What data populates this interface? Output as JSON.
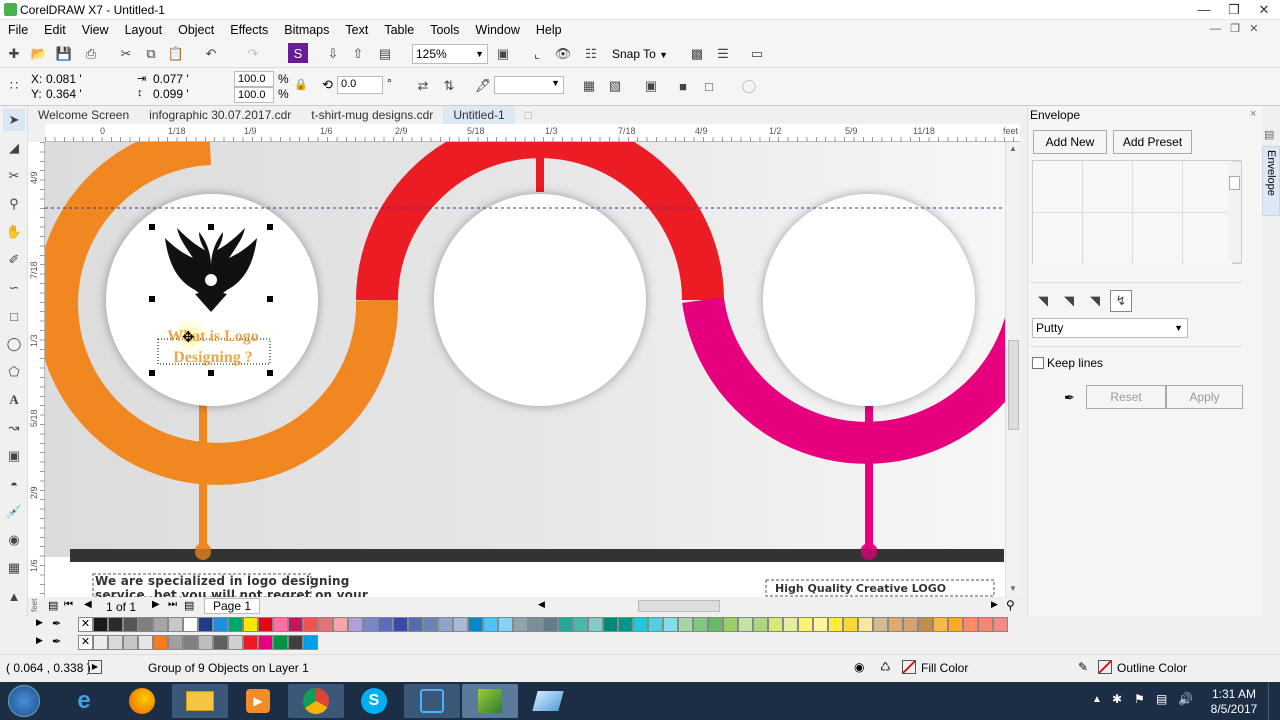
{
  "app": {
    "title": "CorelDRAW X7 - Untitled-1"
  },
  "menu": [
    "File",
    "Edit",
    "View",
    "Layout",
    "Object",
    "Effects",
    "Bitmaps",
    "Text",
    "Table",
    "Tools",
    "Window",
    "Help"
  ],
  "toolbar": {
    "zoom": "125%",
    "snap_to": "Snap To"
  },
  "propbar": {
    "x_label": "X:",
    "x": "0.081 '",
    "y_label": "Y:",
    "y": "0.364 '",
    "w": "0.077 '",
    "h": "0.099 '",
    "sx": "100.0",
    "sy": "100.0",
    "pct": "%",
    "rot": "0.0",
    "deg": "°"
  },
  "tabs": [
    "Welcome Screen",
    "infographic 30.07.2017.cdr",
    "t-shirt-mug designs.cdr",
    "Untitled-1"
  ],
  "ruler": {
    "h_ticks": [
      "0",
      "1/18",
      "1/9",
      "1/6",
      "2/9",
      "5/18",
      "1/3",
      "7/18",
      "4/9",
      "1/2",
      "5/9",
      "11/18"
    ],
    "unit": "feet",
    "v_ticks": [
      "4/9",
      "7/18",
      "1/3",
      "5/18",
      "2/9",
      "1/6"
    ],
    "v_unit": "feet"
  },
  "canvas": {
    "circle_text_line1": "What is Logo",
    "circle_text_line2": "Designing ?",
    "bottom_left_line1": "We are specialized in logo designing",
    "bottom_left_line2": "service, bet you will not regret on your",
    "bottom_right": "High Quality Creative LOGO DESIGNING."
  },
  "docker": {
    "title": "Envelope",
    "add_new": "Add New",
    "add_preset": "Add Preset",
    "mode": "Putty",
    "keep_lines": "Keep lines",
    "reset": "Reset",
    "apply": "Apply",
    "side_tab": "Envelope"
  },
  "pagebar": {
    "count": "1 of 1",
    "page": "Page 1"
  },
  "palette1": [
    "#ffffff",
    "#1a1a1a",
    "#2b2b2b",
    "#555555",
    "#7f7f7f",
    "#a5a5a5",
    "#c8c8c8",
    "#ffffff",
    "#1e3a8a",
    "#1e8fe0",
    "#00a86b",
    "#ffe600",
    "#e30613",
    "#ff6fa5",
    "#c2185b",
    "#ef5350",
    "#e57373",
    "#f6a6a6",
    "#b39ddb",
    "#7986cb",
    "#5c6bc0",
    "#3949ab",
    "#4f6fb0",
    "#6a84b5",
    "#8ea5c9",
    "#aab9d4",
    "#0288d1",
    "#4fc3f7",
    "#81d4fa",
    "#90a4ae",
    "#78909c",
    "#607d8b",
    "#26a69a",
    "#4db6ac",
    "#80cbc4",
    "#00897b",
    "#009688",
    "#26c6da",
    "#4dd0e1",
    "#80deea",
    "#a5d6a7",
    "#81c784",
    "#66bb6a",
    "#9ccc65",
    "#c5e1a5",
    "#aed581",
    "#dce775",
    "#e6ee9c",
    "#fff176",
    "#fff59d",
    "#ffeb3b",
    "#fdd835",
    "#f9e79f",
    "#d7b98e",
    "#e0a96d",
    "#d4a373",
    "#c58b4d",
    "#ffb74d",
    "#ffa726",
    "#ff8a65",
    "#f4876e",
    "#f28b82"
  ],
  "palette2": [
    "#ffffff",
    "#ececec",
    "#d9d9d9",
    "#c6c6c6",
    "#e5e5e5",
    "#f47b20",
    "#a0a0a0",
    "#808080",
    "#bdbdbd",
    "#606060",
    "#d0d0d0",
    "#ed1c24",
    "#e6007e",
    "#009245",
    "#404040",
    "#00a0e9"
  ],
  "status": {
    "coords": "( 0.064 , 0.338  )",
    "object": "Group of 9 Objects on Layer 1",
    "fill": "Fill Color",
    "outline": "Outline Color"
  },
  "clock": {
    "time": "1:31 AM",
    "date": "8/5/2017"
  },
  "colors": {
    "orange": "#f08721",
    "red": "#ec1c24",
    "magenta": "#e6007e",
    "bar": "#333333"
  }
}
